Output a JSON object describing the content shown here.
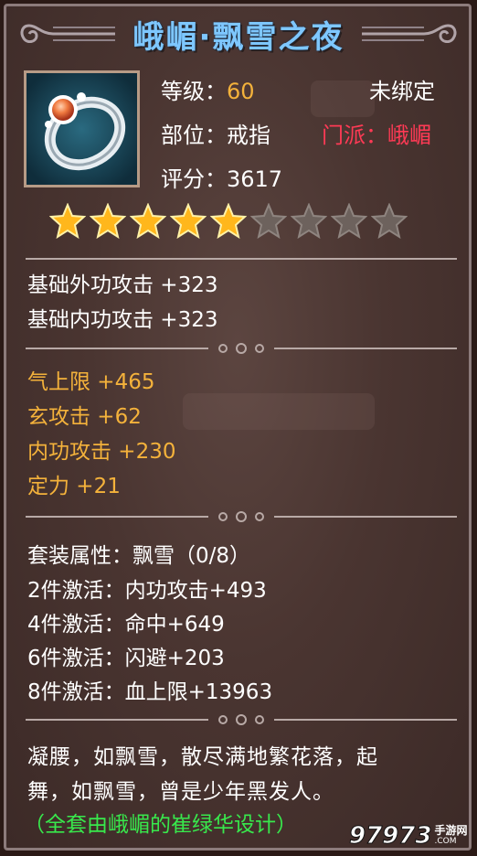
{
  "item": {
    "name": "峨嵋·飘雪之夜",
    "icon": "ring-icon"
  },
  "stats": {
    "level_label": "等级：",
    "level_value": "60",
    "bind_status": "未绑定",
    "slot": "部位：戒指",
    "faction": "门派：峨嵋",
    "score": "评分：3617"
  },
  "rating": {
    "stars_filled": 5,
    "stars_total": 9
  },
  "base_attributes": [
    "基础外功攻击 +323",
    "基础内功攻击 +323"
  ],
  "extra_attributes": [
    "气上限 +465",
    "玄攻击 +62",
    "内功攻击 +230",
    "定力 +21"
  ],
  "set": {
    "title": "套装属性：飘雪（0/8）",
    "bonuses": [
      "2件激活：内功攻击+493",
      "4件激活：命中+649",
      "6件激活：闪避+203",
      "8件激活：血上限+13963"
    ]
  },
  "description": {
    "line1": "凝腰，如飘雪，散尽满地繁花落，起",
    "line2": "舞，如飘雪，曾是少年黑发人。",
    "credit": "（全套由峨嵋的崔绿华设计）"
  },
  "watermark": {
    "digits": "97973",
    "site": "手游网",
    "domain": ".COM"
  },
  "colors": {
    "title": "#7ec7ff",
    "gold": "#f4b23b",
    "faction": "#ff3a55",
    "credit": "#38e84c"
  }
}
